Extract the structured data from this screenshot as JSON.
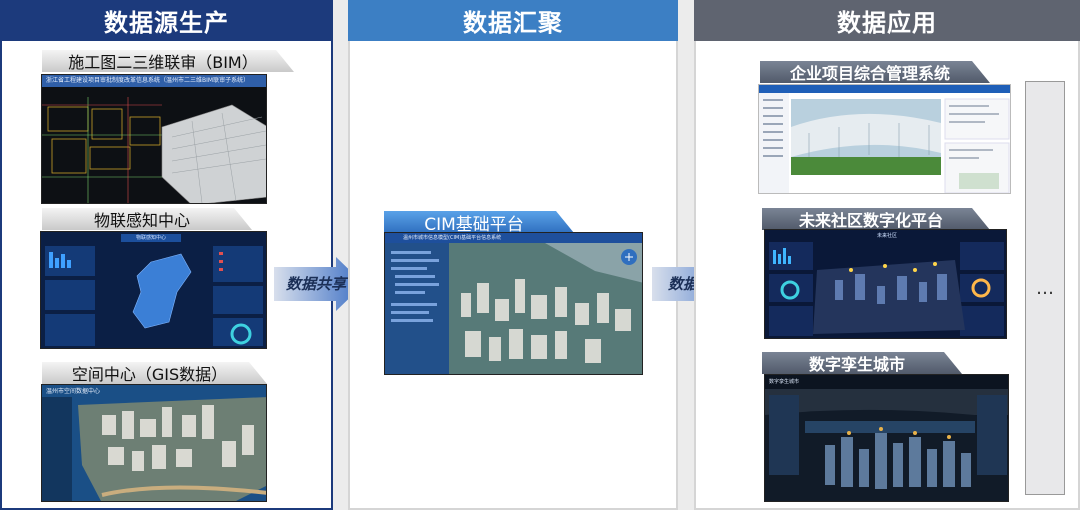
{
  "columns": {
    "source": {
      "title": "数据源生产",
      "color": "#1c3a7c"
    },
    "aggregate": {
      "title": "数据汇聚",
      "color": "#3c7fc4"
    },
    "apply": {
      "title": "数据应用",
      "color": "#5f6470"
    }
  },
  "sources": [
    {
      "label": "施工图二三维联审（BIM）",
      "screen_title": "浙江省工程建设项目审批制度改革信息系统（温州市二三维BIM联审子系统）"
    },
    {
      "label": "物联感知中心",
      "screen_title": "物联感知中心"
    },
    {
      "label": "空间中心（GIS数据）",
      "screen_title": "温州市空间数据中心"
    }
  ],
  "platform": {
    "label": "CIM基础平台",
    "screen_title": "温州市城市信息模型(CIM)基础平台信息系统"
  },
  "arrows": {
    "share": "数据共享",
    "apply": "数据应用"
  },
  "applications": [
    {
      "label": "企业项目综合管理系统"
    },
    {
      "label": "未来社区数字化平台",
      "screen_title": "未来社区"
    },
    {
      "label": "数字孪生城市",
      "screen_title": "数字孪生城市"
    }
  ],
  "more": "…"
}
